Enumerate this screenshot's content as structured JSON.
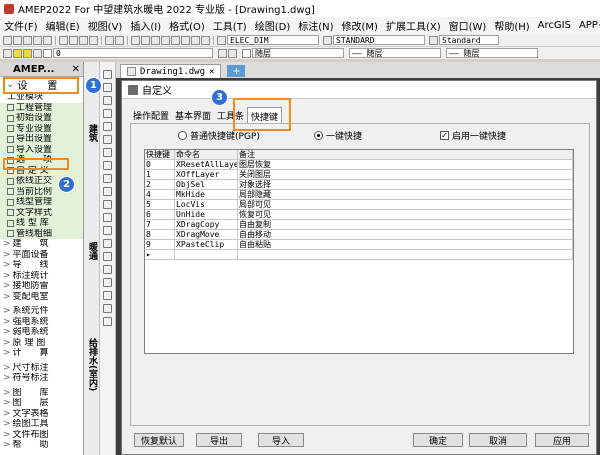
{
  "app": {
    "title": "AMEP2022 For 中望建筑水暖电 2022 专业版 - [Drawing1.dwg]"
  },
  "menu": [
    "文件(F)",
    "编辑(E)",
    "视图(V)",
    "插入(I)",
    "格式(O)",
    "工具(T)",
    "绘图(D)",
    "标注(N)",
    "修改(M)",
    "扩展工具(X)",
    "窗口(W)",
    "帮助(H)",
    "ArcGIS",
    "APP+"
  ],
  "toolbar": {
    "dimstyle": "ELEC_DIM",
    "textstyle": "STANDARD",
    "tablestyle": "Standard",
    "layer": "0",
    "color": "随层",
    "linetype": "—— 随层",
    "lineweight": "—— 随层"
  },
  "sidebar": {
    "title": "AMEP...",
    "close": "✕",
    "settings_tab": "设　　置",
    "groups": [
      {
        "label": "工业模块",
        "style": "plain"
      },
      {
        "label": "工程管理",
        "style": "green"
      },
      {
        "label": "初始设置",
        "style": "green"
      },
      {
        "label": "专业设置",
        "style": "green"
      },
      {
        "label": "导出设置",
        "style": "green"
      },
      {
        "label": "导入设置",
        "style": "green"
      },
      {
        "label": "选　　项",
        "style": "green"
      },
      {
        "label": "自 定 义",
        "style": "green"
      },
      {
        "label": "依线正交",
        "style": "green"
      },
      {
        "label": "当前比例",
        "style": "green"
      },
      {
        "label": "线型管理",
        "style": "green"
      },
      {
        "label": "文字样式",
        "style": "green"
      },
      {
        "label": "线 型 库",
        "style": "green"
      },
      {
        "label": "管线粗细",
        "style": "green"
      },
      {
        "label": "建　　筑",
        "style": "sub"
      },
      {
        "label": "平面设备",
        "style": "sub"
      },
      {
        "label": "导　　线",
        "style": "sub"
      },
      {
        "label": "标注统计",
        "style": "sub"
      },
      {
        "label": "接地防雷",
        "style": "sub"
      },
      {
        "label": "变配电室",
        "style": "sub"
      },
      {
        "label": "系统元件",
        "style": "sub gap"
      },
      {
        "label": "强电系统",
        "style": "sub"
      },
      {
        "label": "弱电系统",
        "style": "sub"
      },
      {
        "label": "原 理 图",
        "style": "sub"
      },
      {
        "label": "计　　算",
        "style": "sub"
      },
      {
        "label": "尺寸标注",
        "style": "sub gap"
      },
      {
        "label": "符号标注",
        "style": "sub"
      },
      {
        "label": "图　　库",
        "style": "sub gap"
      },
      {
        "label": "图　　层",
        "style": "sub"
      },
      {
        "label": "文字表格",
        "style": "sub"
      },
      {
        "label": "绘图工具",
        "style": "sub"
      },
      {
        "label": "文件布图",
        "style": "sub"
      },
      {
        "label": "帮　　助",
        "style": "sub"
      }
    ]
  },
  "vertical_tabs": [
    "建筑",
    "暖通",
    "给排水(室内)"
  ],
  "document": {
    "tab": "Drawing1.dwg",
    "close": "✕",
    "add": "+"
  },
  "dialog": {
    "title": "自定义",
    "tabs": [
      "操作配置",
      "基本界面",
      "工具条",
      "快捷键"
    ],
    "active_tab": "快捷键",
    "radio_pgp": "普通快捷键(PGP)",
    "radio_onekey": "一键快捷",
    "checkbox_enable": "启用一键快捷",
    "checkbox_checked": true,
    "grid": {
      "headers": [
        "快捷键",
        "命令名",
        "备注"
      ],
      "rows": [
        [
          "0",
          "XResetAllLaye",
          "图层恢复"
        ],
        [
          "1",
          "XOffLayer",
          "关闭图层"
        ],
        [
          "2",
          "ObjSel",
          "对象选择"
        ],
        [
          "4",
          "MkHide",
          "局部隐藏"
        ],
        [
          "5",
          "LocVis",
          "局部可见"
        ],
        [
          "6",
          "UnHide",
          "恢复可见"
        ],
        [
          "7",
          "XDragCopy",
          "自由复制"
        ],
        [
          "8",
          "XDragMove",
          "自由移动"
        ],
        [
          "9",
          "XPasteClip",
          "自由粘贴"
        ]
      ],
      "new_row_marker": "▸"
    },
    "buttons": {
      "restore": "恢复默认",
      "export": "导出",
      "import": "导入",
      "ok": "确定",
      "cancel": "取消",
      "apply": "应用"
    }
  },
  "callouts": [
    "1",
    "2",
    "3"
  ],
  "colors": {
    "accent": "#2f6fd1",
    "highlight": "#f08c1e",
    "green_bg": "#e3f1d9"
  }
}
